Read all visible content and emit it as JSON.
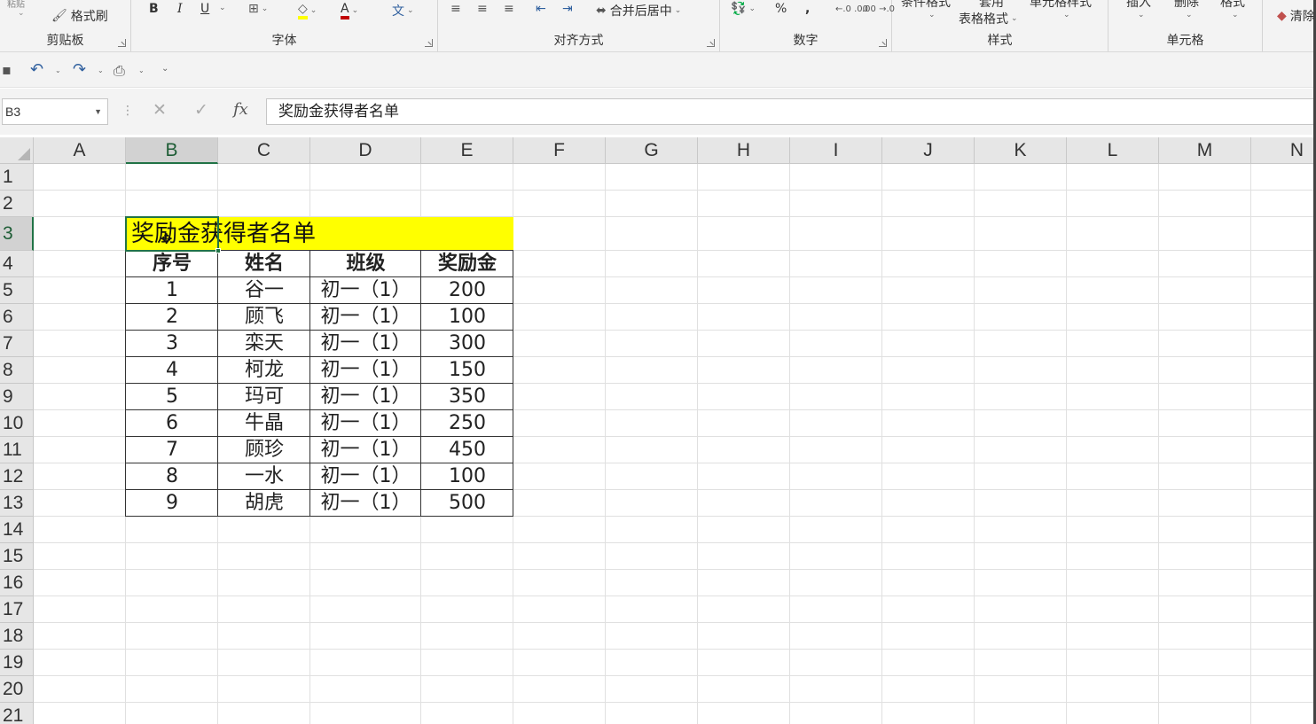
{
  "ribbon": {
    "clipboard": {
      "label": "剪贴板",
      "format_painter": "格式刷",
      "paste_partial": "粘贴"
    },
    "font": {
      "label": "字体",
      "bold": "B",
      "italic": "I",
      "underline": "U"
    },
    "alignment": {
      "label": "对齐方式",
      "merge_center": "合并后居中"
    },
    "number": {
      "label": "数字",
      "percent": "%",
      "comma": ",",
      "inc_decimal": "←.0 .00",
      "dec_decimal": ".00 →.0"
    },
    "styles": {
      "label": "样式",
      "conditional": "条件格式",
      "table_format": "表格格式",
      "apply": "套用",
      "cell_styles": "单元格样式"
    },
    "cells": {
      "label": "单元格",
      "insert": "插入",
      "delete": "删除",
      "format": "格式"
    },
    "editing": {
      "clear": "清除"
    }
  },
  "formula_bar": {
    "name_box": "B3",
    "fx": "fx",
    "content": "奖励金获得者名单"
  },
  "sheet": {
    "columns": [
      "A",
      "B",
      "C",
      "D",
      "E",
      "F",
      "G",
      "H",
      "I",
      "J",
      "K",
      "L",
      "M",
      "N"
    ],
    "rows": [
      "1",
      "2",
      "3",
      "4",
      "5",
      "6",
      "7",
      "8",
      "9",
      "10",
      "11",
      "12",
      "13",
      "14",
      "15",
      "16",
      "17",
      "18",
      "19",
      "20",
      "21"
    ],
    "selected_column": "B",
    "selected_row": "3",
    "title": "奖励金获得者名单",
    "title_fill": "#ffff00",
    "table": {
      "headers": [
        "序号",
        "姓名",
        "班级",
        "奖励金"
      ],
      "rows": [
        [
          "1",
          "谷一",
          "初一（1）",
          "200"
        ],
        [
          "2",
          "顾飞",
          "初一（1）",
          "100"
        ],
        [
          "3",
          "栾天",
          "初一（1）",
          "300"
        ],
        [
          "4",
          "柯龙",
          "初一（1）",
          "150"
        ],
        [
          "5",
          "玛可",
          "初一（1）",
          "350"
        ],
        [
          "6",
          "牛晶",
          "初一（1）",
          "250"
        ],
        [
          "7",
          "顾珍",
          "初一（1）",
          "450"
        ],
        [
          "8",
          "一水",
          "初一（1）",
          "100"
        ],
        [
          "9",
          "胡虎",
          "初一（1）",
          "500"
        ]
      ]
    }
  },
  "colors": {
    "accent": "#217346",
    "ribbon_bg": "#f3f3f3",
    "header_bg": "#e6e6e6"
  }
}
